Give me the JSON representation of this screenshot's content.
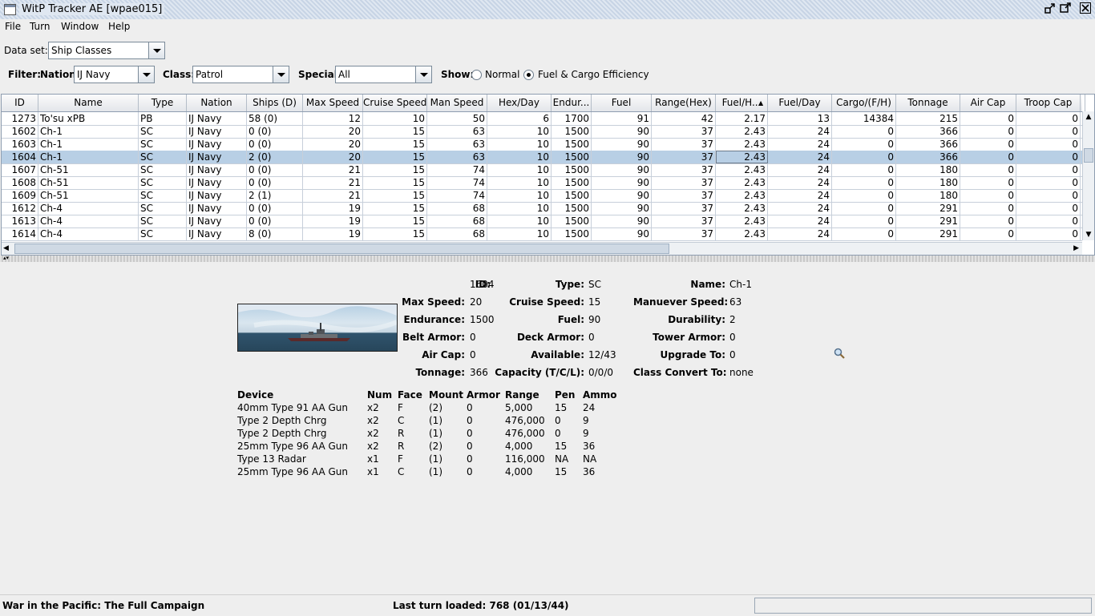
{
  "window": {
    "title": "WitP Tracker AE [wpae015]"
  },
  "menu": [
    "File",
    "Turn",
    "Window",
    "Help"
  ],
  "dataset": {
    "label": "Data set:",
    "value": "Ship Classes"
  },
  "filter": {
    "label": "Filter:",
    "nation_label": "Nation:",
    "nation_value": "IJ Navy",
    "class_label": "Class:",
    "class_value": "Patrol",
    "special_label": "Special:",
    "special_value": "All",
    "show_label": "Show:",
    "show_options": [
      "Normal",
      "Fuel & Cargo Efficiency"
    ],
    "show_selected": "Fuel & Cargo Efficiency"
  },
  "table": {
    "columns": [
      "ID",
      "Name",
      "Type",
      "Nation",
      "Ships (D)",
      "Max Speed",
      "Cruise Speed",
      "Man Speed",
      "Hex/Day",
      "Endur...",
      "Fuel",
      "Range(Hex)",
      "Fuel/H...",
      "Fuel/Day",
      "Cargo/(F/H)",
      "Tonnage",
      "Air Cap",
      "Troop Cap"
    ],
    "rows": [
      [
        "1273",
        "To'su xPB",
        "PB",
        "IJ Navy",
        "58 (0)",
        "12",
        "10",
        "50",
        "6",
        "1700",
        "91",
        "42",
        "2.17",
        "13",
        "14384",
        "215",
        "0",
        "0"
      ],
      [
        "1602",
        "Ch-1",
        "SC",
        "IJ Navy",
        "0 (0)",
        "20",
        "15",
        "63",
        "10",
        "1500",
        "90",
        "37",
        "2.43",
        "24",
        "0",
        "366",
        "0",
        "0"
      ],
      [
        "1603",
        "Ch-1",
        "SC",
        "IJ Navy",
        "0 (0)",
        "20",
        "15",
        "63",
        "10",
        "1500",
        "90",
        "37",
        "2.43",
        "24",
        "0",
        "366",
        "0",
        "0"
      ],
      [
        "1604",
        "Ch-1",
        "SC",
        "IJ Navy",
        "2 (0)",
        "20",
        "15",
        "63",
        "10",
        "1500",
        "90",
        "37",
        "2.43",
        "24",
        "0",
        "366",
        "0",
        "0"
      ],
      [
        "1607",
        "Ch-51",
        "SC",
        "IJ Navy",
        "0 (0)",
        "21",
        "15",
        "74",
        "10",
        "1500",
        "90",
        "37",
        "2.43",
        "24",
        "0",
        "180",
        "0",
        "0"
      ],
      [
        "1608",
        "Ch-51",
        "SC",
        "IJ Navy",
        "0 (0)",
        "21",
        "15",
        "74",
        "10",
        "1500",
        "90",
        "37",
        "2.43",
        "24",
        "0",
        "180",
        "0",
        "0"
      ],
      [
        "1609",
        "Ch-51",
        "SC",
        "IJ Navy",
        "2 (1)",
        "21",
        "15",
        "74",
        "10",
        "1500",
        "90",
        "37",
        "2.43",
        "24",
        "0",
        "180",
        "0",
        "0"
      ],
      [
        "1612",
        "Ch-4",
        "SC",
        "IJ Navy",
        "0 (0)",
        "19",
        "15",
        "68",
        "10",
        "1500",
        "90",
        "37",
        "2.43",
        "24",
        "0",
        "291",
        "0",
        "0"
      ],
      [
        "1613",
        "Ch-4",
        "SC",
        "IJ Navy",
        "0 (0)",
        "19",
        "15",
        "68",
        "10",
        "1500",
        "90",
        "37",
        "2.43",
        "24",
        "0",
        "291",
        "0",
        "0"
      ],
      [
        "1614",
        "Ch-4",
        "SC",
        "IJ Navy",
        "8 (0)",
        "19",
        "15",
        "68",
        "10",
        "1500",
        "90",
        "37",
        "2.43",
        "24",
        "0",
        "291",
        "0",
        "0"
      ]
    ],
    "selected_id": "1604"
  },
  "detail": {
    "id": {
      "label": "ID:",
      "value": "1604"
    },
    "type": {
      "label": "Type:",
      "value": "SC"
    },
    "name": {
      "label": "Name:",
      "value": "Ch-1"
    },
    "max_speed": {
      "label": "Max Speed:",
      "value": "20"
    },
    "cruise_speed": {
      "label": "Cruise Speed:",
      "value": "15"
    },
    "maneuver_speed": {
      "label": "Manuever Speed:",
      "value": "63"
    },
    "endurance": {
      "label": "Endurance:",
      "value": "1500"
    },
    "fuel": {
      "label": "Fuel:",
      "value": "90"
    },
    "durability": {
      "label": "Durability:",
      "value": "2"
    },
    "belt_armor": {
      "label": "Belt Armor:",
      "value": "0"
    },
    "deck_armor": {
      "label": "Deck Armor:",
      "value": "0"
    },
    "tower_armor": {
      "label": "Tower Armor:",
      "value": "0"
    },
    "air_cap": {
      "label": "Air Cap:",
      "value": "0"
    },
    "available": {
      "label": "Available:",
      "value": "12/43"
    },
    "upgrade_to": {
      "label": "Upgrade To:",
      "value": "0"
    },
    "tonnage": {
      "label": "Tonnage:",
      "value": "366"
    },
    "capacity": {
      "label": "Capacity (T/C/L):",
      "value": "0/0/0"
    },
    "class_convert": {
      "label": "Class Convert To:",
      "value": "none"
    }
  },
  "devices": {
    "headers": [
      "Device",
      "Num",
      "Face",
      "Mount",
      "Armor",
      "Range",
      "Pen",
      "Ammo"
    ],
    "rows": [
      [
        "40mm Type 91 AA Gun",
        "x2",
        "F",
        "(2)",
        "0",
        "5,000",
        "15",
        "24"
      ],
      [
        "Type 2 Depth Chrg",
        "x2",
        "C",
        "(1)",
        "0",
        "476,000",
        "0",
        "9"
      ],
      [
        "Type 2 Depth Chrg",
        "x2",
        "R",
        "(1)",
        "0",
        "476,000",
        "0",
        "9"
      ],
      [
        "25mm Type 96 AA Gun",
        "x2",
        "R",
        "(2)",
        "0",
        "4,000",
        "15",
        "36"
      ],
      [
        "Type 13 Radar",
        "x1",
        "F",
        "(1)",
        "0",
        "116,000",
        "NA",
        "NA"
      ],
      [
        "25mm Type 96 AA Gun",
        "x1",
        "C",
        "(1)",
        "0",
        "4,000",
        "15",
        "36"
      ]
    ]
  },
  "status": {
    "left": "War in the Pacific: The Full Campaign",
    "center": "Last turn loaded: 768 (01/13/44)"
  }
}
